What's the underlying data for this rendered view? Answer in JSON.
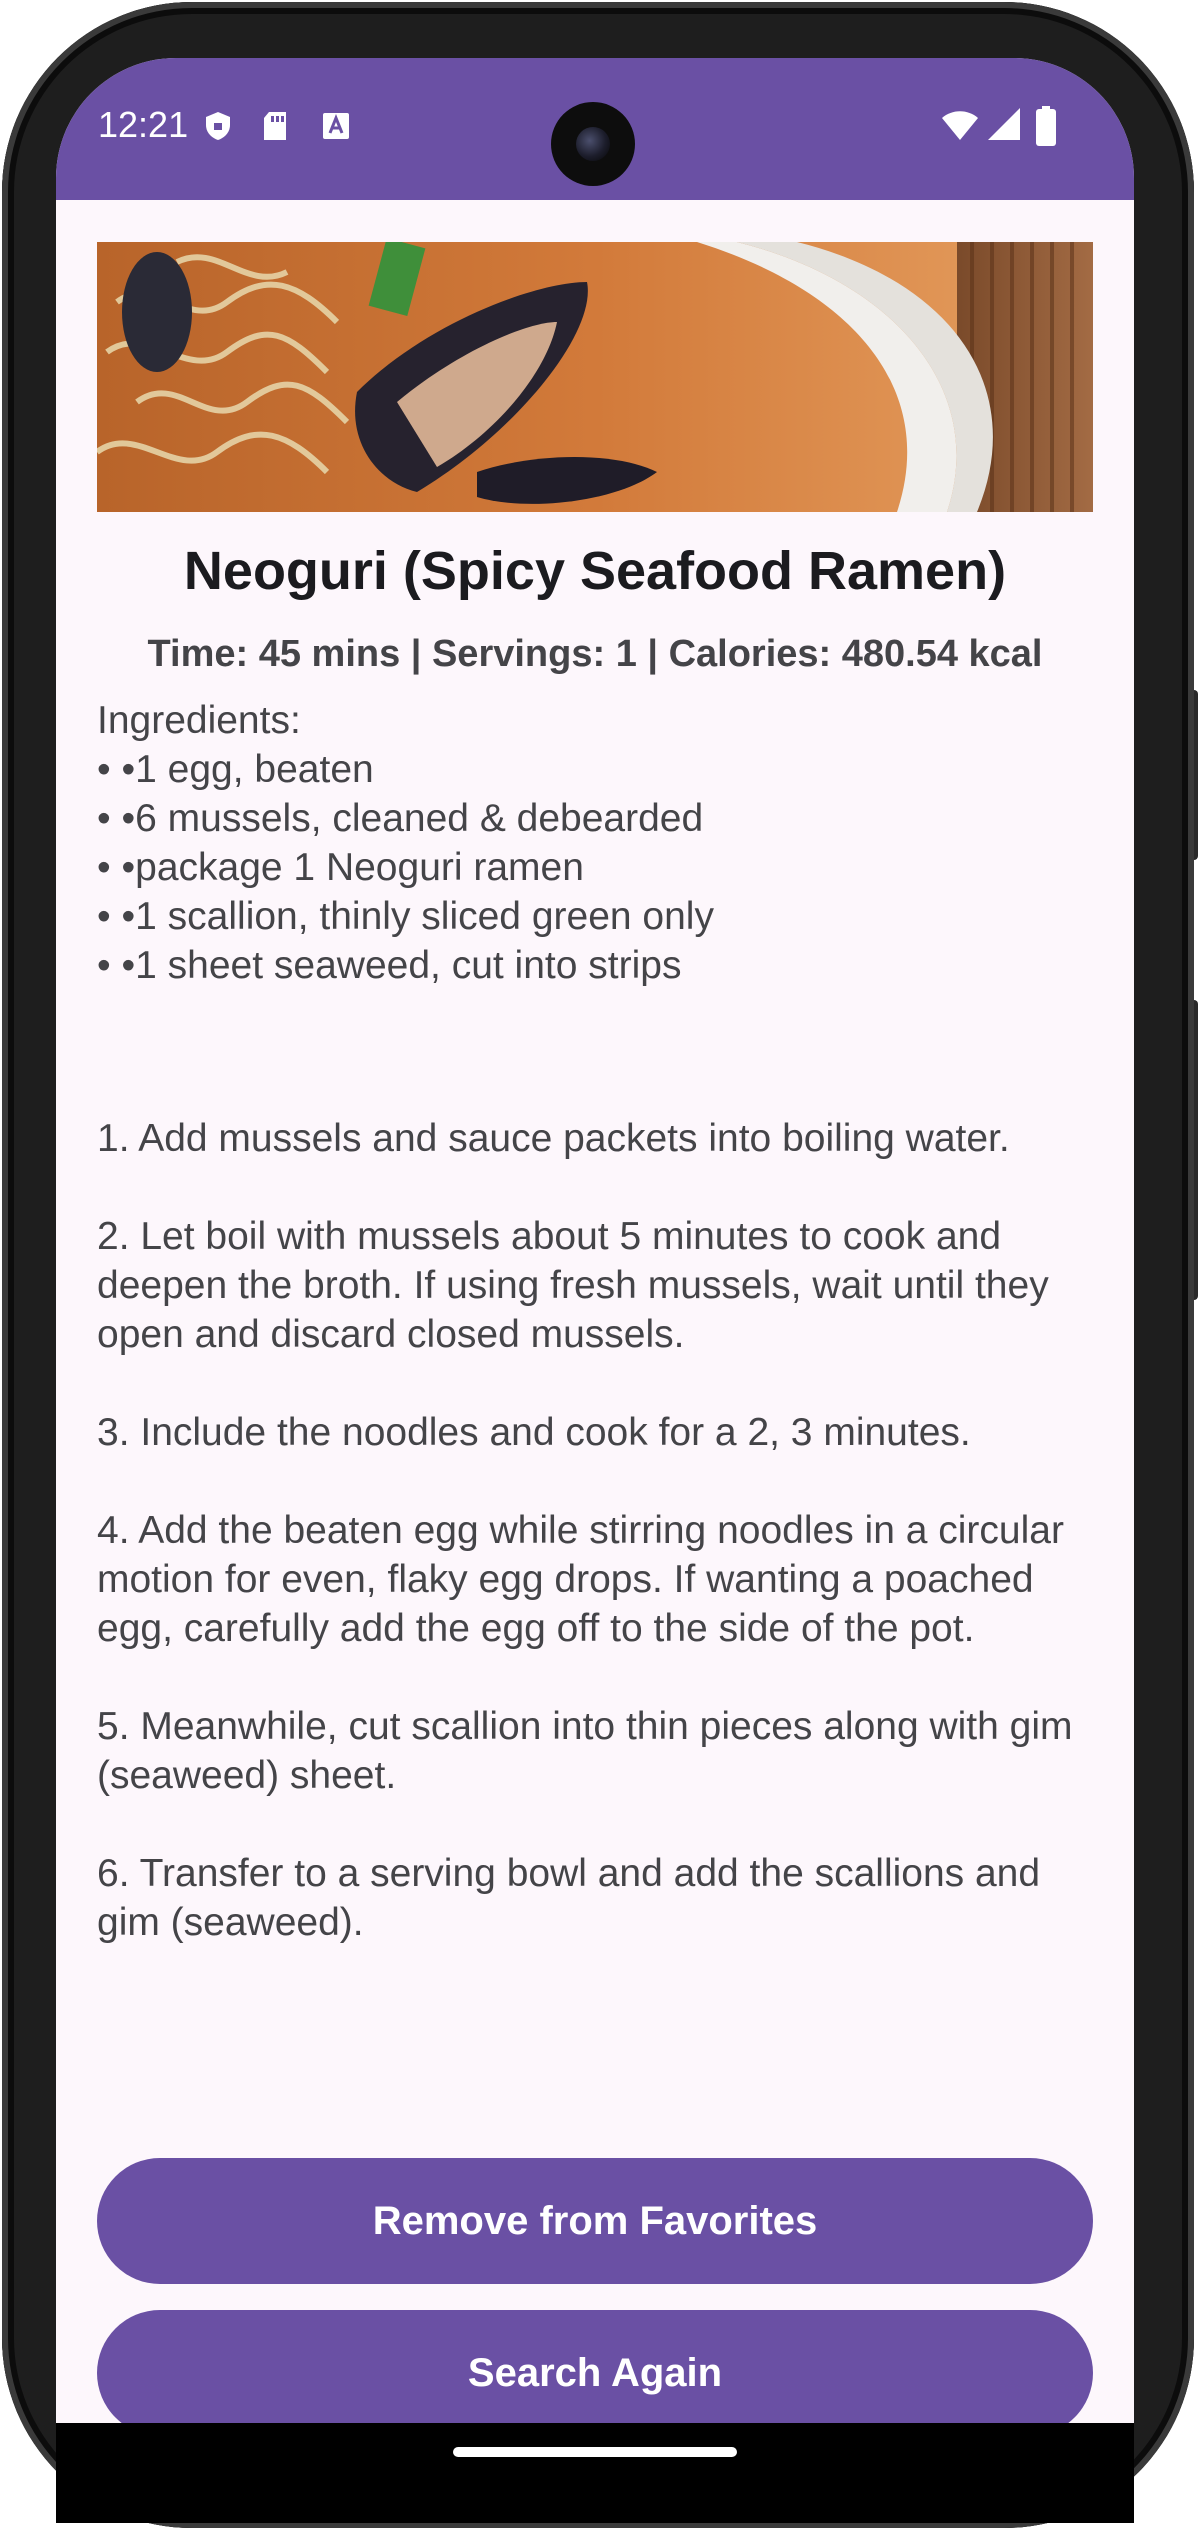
{
  "status_bar": {
    "time": "12:21",
    "left_icons": [
      "shield-icon",
      "sd-card-icon",
      "text-a-icon"
    ],
    "right_icons": [
      "wifi-icon",
      "signal-icon",
      "battery-icon"
    ],
    "background": "#6a50a4"
  },
  "recipe": {
    "title": "Neoguri (Spicy Seafood Ramen)",
    "meta": "Time: 45 mins | Servings: 1 | Calories: 480.54 kcal",
    "ingredients_heading": "Ingredients:",
    "ingredients": [
      "• •1 egg, beaten",
      "• •6 mussels, cleaned & debearded",
      "• •package 1 Neoguri ramen",
      "• •1 scallion, thinly sliced green only",
      "• •1 sheet seaweed, cut into strips"
    ],
    "steps": [
      "1. Add mussels and sauce packets into boiling water.",
      "2. Let boil with mussels about 5 minutes to cook and deepen the broth. If using fresh mussels, wait until they open and discard closed mussels.",
      "3. Include the noodles and cook for a 2, 3 minutes.",
      "4. Add the beaten egg while stirring noodles in a circular motion for even, flaky egg drops. If wanting a poached egg, carefully add the egg off to the side of the pot.",
      "5. Meanwhile, cut scallion into thin pieces along with gim (seaweed) sheet.",
      "6. Transfer to a serving bowl and add the scallions and gim (seaweed)."
    ]
  },
  "buttons": {
    "remove_favorites": "Remove from Favorites",
    "search_again": "Search Again"
  },
  "colors": {
    "accent": "#6a50a4",
    "background": "#fdf7fc",
    "body_text": "#444448",
    "title_text": "#1b1b1f"
  }
}
